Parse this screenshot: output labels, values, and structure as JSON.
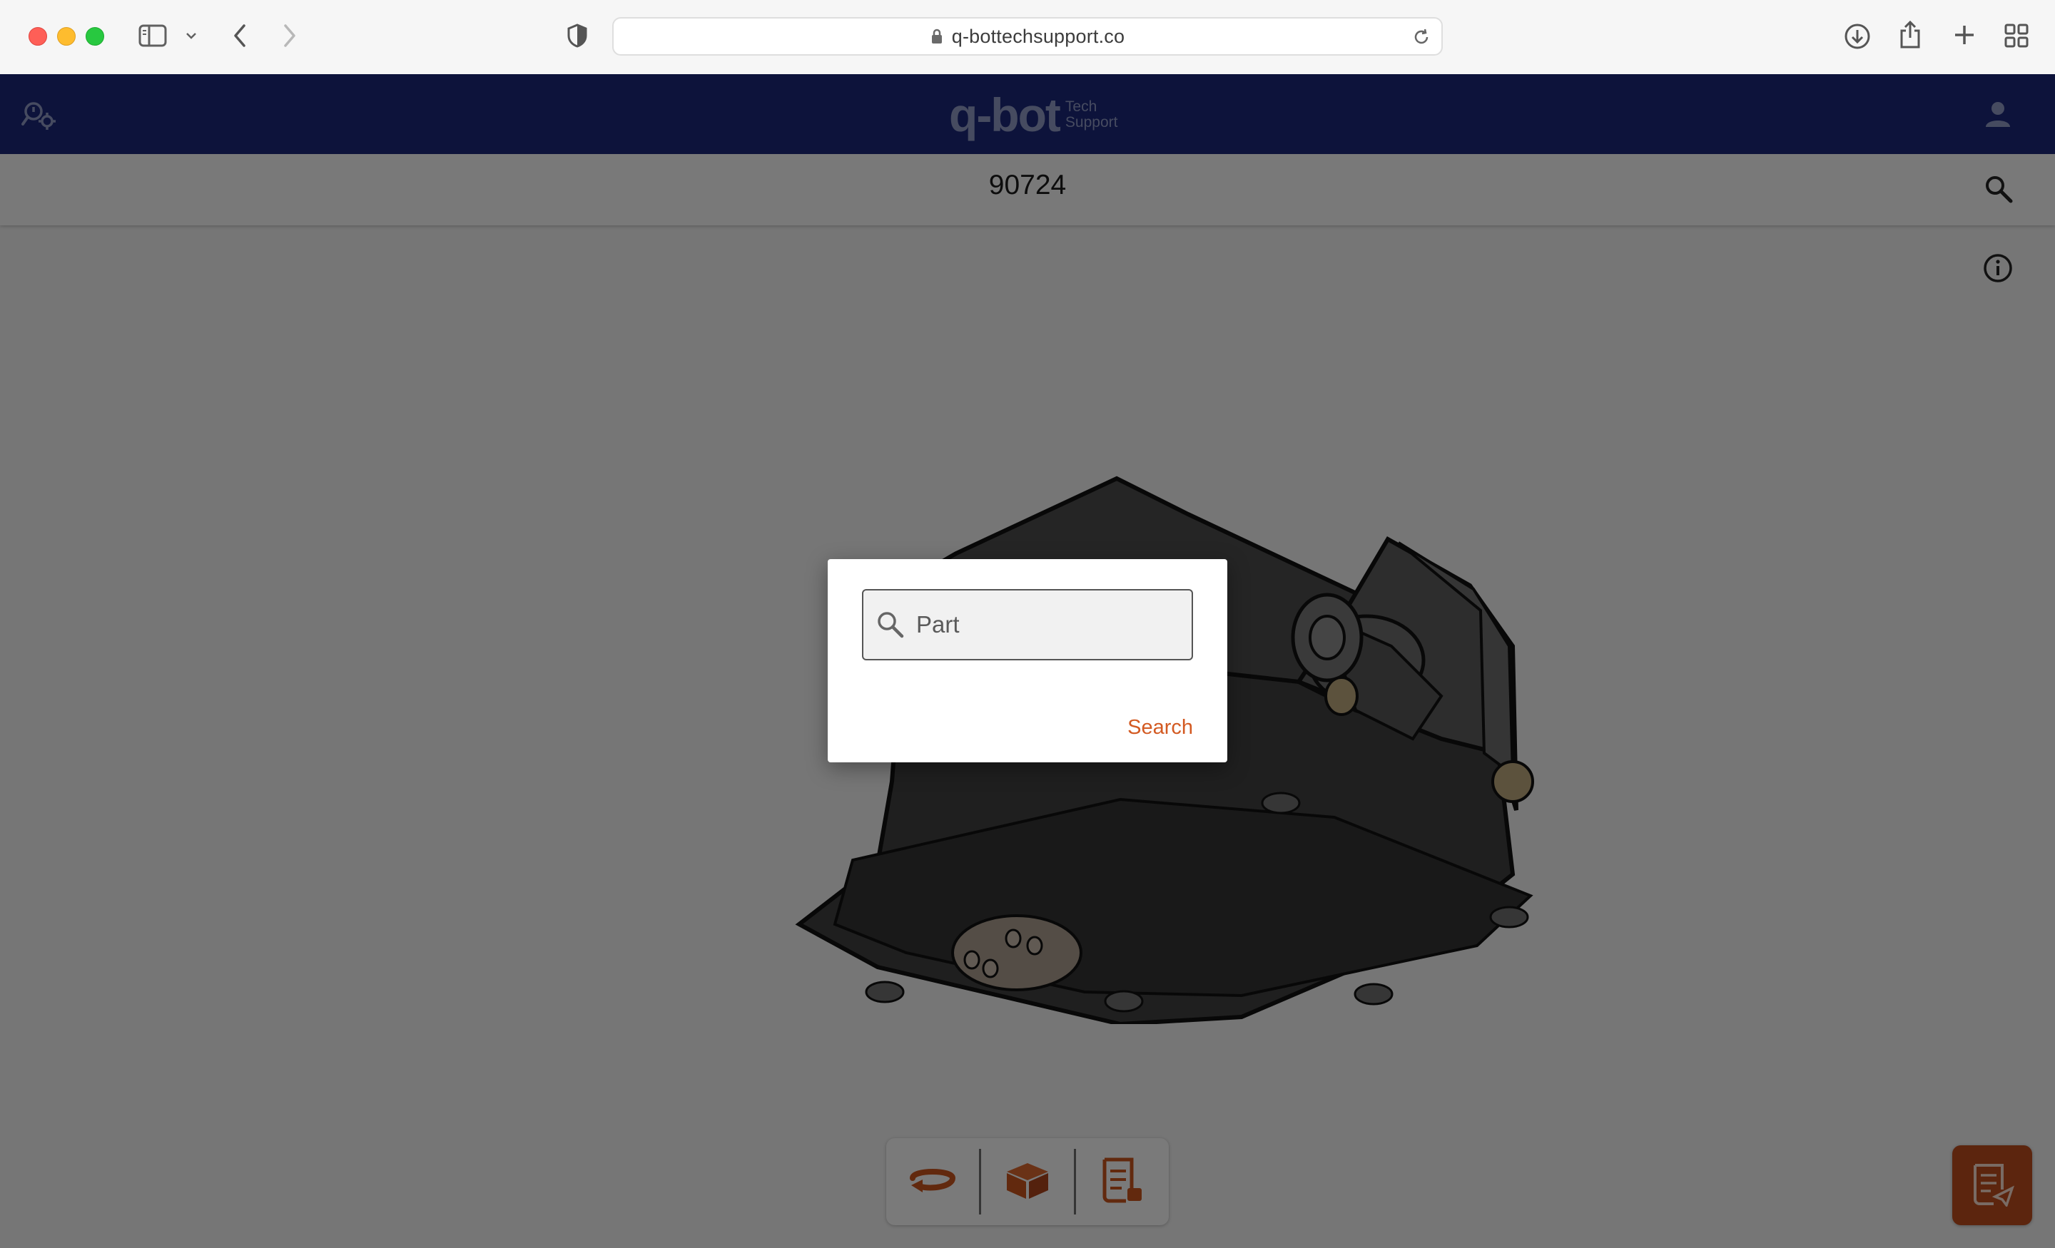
{
  "browser": {
    "url": "q-bottechsupport.co",
    "icons": [
      "sidebar-icon",
      "chevron-down-icon",
      "back-icon",
      "forward-icon",
      "shield-icon",
      "lock-icon",
      "reload-icon",
      "download-icon",
      "share-icon",
      "new-tab-icon",
      "tab-overview-icon"
    ]
  },
  "header": {
    "logo_word": "q-bot",
    "logo_sub_1": "Tech",
    "logo_sub_2": "Support",
    "background": "#1b2776",
    "icons": [
      "tools-icon",
      "user-icon"
    ]
  },
  "subheader": {
    "part_number": "90724",
    "icons": [
      "search-icon",
      "info-icon"
    ]
  },
  "toolbar": {
    "icons": [
      "rotate-icon",
      "box-icon",
      "parts-list-icon"
    ],
    "accent": "#c4521d"
  },
  "fab": {
    "icon": "parts-list-icon",
    "color": "#b84a1c"
  },
  "dialog": {
    "placeholder": "Part",
    "search_label": "Search",
    "accent": "#d35a22"
  }
}
